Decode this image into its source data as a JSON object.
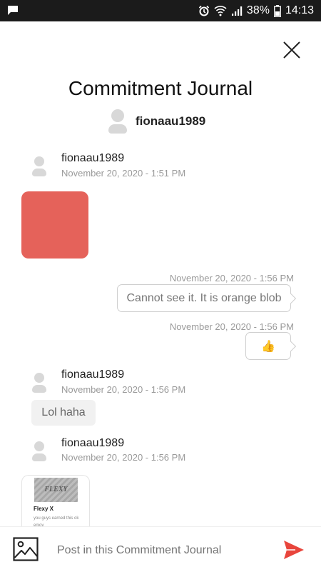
{
  "status_bar": {
    "battery_percent": "38%",
    "time": "14:13",
    "icons": [
      "chat-notification-icon",
      "alarm-icon",
      "wifi-icon",
      "signal-icon",
      "battery-icon"
    ]
  },
  "header": {
    "title": "Commitment Journal",
    "owner_name": "fionaau1989"
  },
  "messages": [
    {
      "author": "fionaau1989",
      "time": "November 20, 2020 - 1:51 PM",
      "type": "image",
      "image_color": "#e5625a"
    },
    {
      "time": "November 20, 2020 - 1:56 PM",
      "text": "Cannot see it. It is orange blob",
      "direction": "outgoing"
    },
    {
      "time": "November 20, 2020 - 1:56 PM",
      "emoji": "👍",
      "direction": "outgoing"
    },
    {
      "author": "fionaau1989",
      "time": "November 20, 2020 - 1:56 PM",
      "text": "Lol haha"
    },
    {
      "author": "fionaau1989",
      "time": "November 20, 2020 - 1:56 PM",
      "type": "link",
      "card": {
        "thumb_text": "FLEXY",
        "title": "Flexy X",
        "desc": "you guys earned this ok enjoy"
      }
    }
  ],
  "composer": {
    "placeholder": "Post in this Commitment Journal"
  },
  "colors": {
    "accent": "#e8453c",
    "status_bar_bg": "#1b1b1b",
    "avatar_gray": "#d8d8d8"
  }
}
